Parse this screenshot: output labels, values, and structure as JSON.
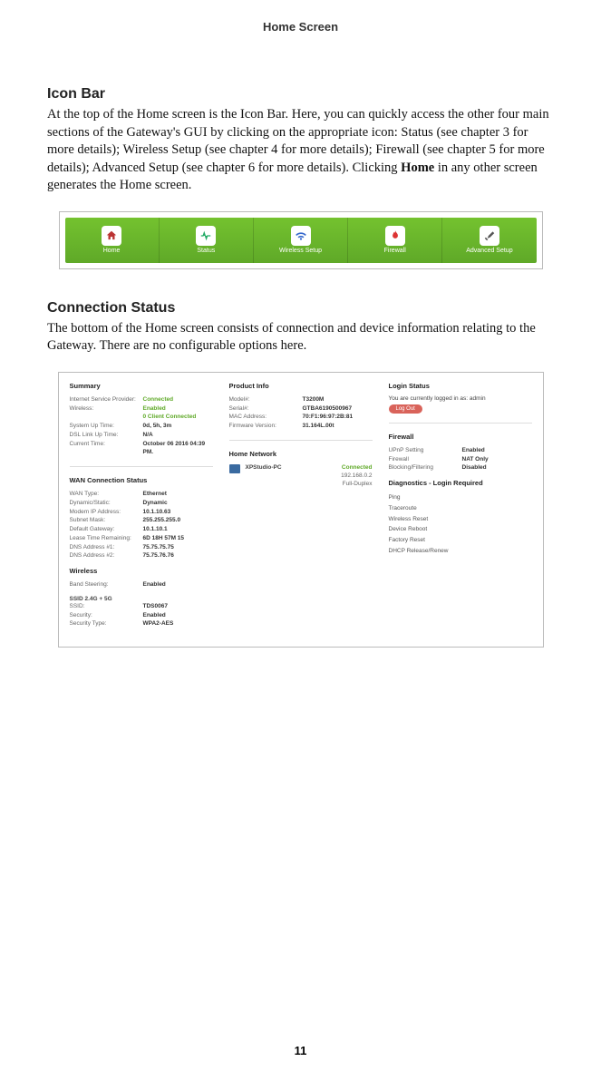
{
  "page_header": "Home Screen",
  "page_number": "11",
  "section1": {
    "heading": "Icon Bar",
    "body_pre": "At the top of the Home screen is the Icon Bar. Here, you can quickly access the other four main sections of the Gateway's GUI by clicking on the appropriate icon: Status (see chapter 3 for more details); Wireless Setup (see chapter 4 for more details); Firewall (see chapter 5 for more details); Advanced Setup (see chapter 6 for more details). Clicking ",
    "body_bold": "Home",
    "body_post": " in any other screen generates the Home screen."
  },
  "iconbar": {
    "items": [
      {
        "label": "Home",
        "icon": "home"
      },
      {
        "label": "Status",
        "icon": "status"
      },
      {
        "label": "Wireless Setup",
        "icon": "wireless"
      },
      {
        "label": "Firewall",
        "icon": "firewall"
      },
      {
        "label": "Advanced Setup",
        "icon": "advanced"
      }
    ]
  },
  "section2": {
    "heading": "Connection Status",
    "body": "The bottom of the Home screen consists of connection and device information relating to the Gateway. There are no configurable options here."
  },
  "status": {
    "summary": {
      "heading": "Summary",
      "rows": [
        {
          "k": "Internet Service Provider:",
          "v": "Connected",
          "green": true
        },
        {
          "k": "Wireless:",
          "v": "Enabled",
          "green": true
        },
        {
          "k": "",
          "v": "0 Client Connected",
          "green": true
        },
        {
          "k": "System Up Time:",
          "v": "0d, 5h, 3m"
        },
        {
          "k": "DSL Link Up Time:",
          "v": "N/A"
        },
        {
          "k": "Current Time:",
          "v": "October 06 2016 04:39 PM."
        }
      ]
    },
    "product": {
      "heading": "Product Info",
      "rows": [
        {
          "k": "Model#:",
          "v": "T3200M"
        },
        {
          "k": "Serial#:",
          "v": "GTBA6190500967"
        },
        {
          "k": "MAC Address:",
          "v": "70:F1:96:97:2B:81"
        },
        {
          "k": "Firmware Version:",
          "v": "31.164L.00t"
        }
      ]
    },
    "login": {
      "heading": "Login Status",
      "text": "You are currently logged in as: admin",
      "button": "Log Out"
    },
    "wan": {
      "heading": "WAN Connection Status",
      "rows": [
        {
          "k": "WAN Type:",
          "v": "Ethernet"
        },
        {
          "k": "Dynamic/Static:",
          "v": "Dynamic"
        },
        {
          "k": "Modem IP Address:",
          "v": "10.1.10.63"
        },
        {
          "k": "Subnet Mask:",
          "v": "255.255.255.0"
        },
        {
          "k": "Default Gateway:",
          "v": "10.1.10.1"
        },
        {
          "k": "Lease Time Remaining:",
          "v": "6D 18H 57M 15"
        },
        {
          "k": "DNS Address #1:",
          "v": "75.75.75.75"
        },
        {
          "k": "DNS Address #2:",
          "v": "75.75.76.76"
        }
      ]
    },
    "wireless": {
      "heading": "Wireless",
      "band_row": {
        "k": "Band Steering:",
        "v": "Enabled"
      },
      "ssid_heading": "SSID 2.4G + 5G",
      "rows": [
        {
          "k": "SSID:",
          "v": "TDS0067"
        },
        {
          "k": "Security:",
          "v": "Enabled"
        },
        {
          "k": "Security Type:",
          "v": "WPA2-AES"
        }
      ]
    },
    "home_network": {
      "heading": "Home Network",
      "device": "XPStudio-PC",
      "status": "Connected",
      "ip": "192.168.0.2",
      "duplex": "Full-Duplex"
    },
    "firewall": {
      "heading": "Firewall",
      "rows": [
        {
          "k": "UPnP Setting",
          "v": "Enabled"
        },
        {
          "k": "Firewall",
          "v": "NAT Only"
        },
        {
          "k": "Blocking/Filtering",
          "v": "Disabled"
        }
      ]
    },
    "diagnostics": {
      "heading": "Diagnostics - Login Required",
      "items": [
        "Ping",
        "Traceroute",
        "Wireless Reset",
        "Device Reboot",
        "Factory Reset",
        "DHCP Release/Renew"
      ]
    }
  }
}
